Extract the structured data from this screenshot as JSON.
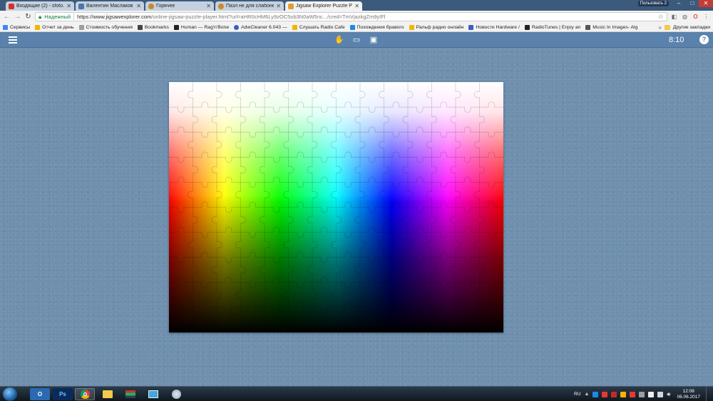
{
  "browser": {
    "tabs": [
      {
        "title": "Входящие (2) - sfoto.onl@",
        "favicon_color": "#d93025",
        "active": false
      },
      {
        "title": "Валентин Маслаков",
        "favicon_color": "#4a76a8",
        "active": false
      },
      {
        "title": "Горячее",
        "favicon_color": "#c88a2a",
        "active": false
      },
      {
        "title": "Пазл не для слабонервных",
        "favicon_color": "#c88a2a",
        "active": false
      },
      {
        "title": "Jigsaw Explorer Puzzle P",
        "favicon_color": "#e0a030",
        "active": true
      }
    ],
    "profile_label": "Пользовать 2",
    "close_symbol": "✕",
    "address": {
      "secure_label": "Надежный",
      "url_host": "https://www.jigsawexplorer.com",
      "url_rest": "/online-jigsaw-puzzle-player.html?url=aHR0cHM6Ly9zOC5ob3N0aW5nc.../cred=TmVjazkgZm9yIFl"
    },
    "bookmarks": [
      {
        "label": "Сервисы",
        "color": "#4285f4"
      },
      {
        "label": "Отчет за день",
        "color": "#f4b400"
      },
      {
        "label": "Стоимость обучения",
        "color": "#9e9e9e"
      },
      {
        "label": "Bookmarks",
        "color": "#444444"
      },
      {
        "label": "Human — Rag'n'Bone",
        "color": "#222222"
      },
      {
        "label": "AdwCleaner 6.043 —",
        "color": "#3b5fc0"
      },
      {
        "label": "Слушать Radio Cafe",
        "color": "#f4b400"
      },
      {
        "label": "Похождения бравого",
        "color": "#1e88e5"
      },
      {
        "label": "Ральф радио онлайн",
        "color": "#f4b400"
      },
      {
        "label": "Новости Hardware /",
        "color": "#3b5fc0"
      },
      {
        "label": "RadioTunes | Enjoy an",
        "color": "#222222"
      },
      {
        "label": "Music In Images- Alg",
        "color": "#555555"
      }
    ],
    "other_bookmarks": "Другие закладки"
  },
  "app": {
    "timer": "8:10",
    "help_label": "?",
    "tools": [
      {
        "name": "hand-tool-icon",
        "glyph": "✋"
      },
      {
        "name": "fullscreen-icon",
        "glyph": "▭"
      },
      {
        "name": "image-preview-icon",
        "glyph": "▣"
      }
    ]
  },
  "taskbar": {
    "items": [
      {
        "name": "taskbar-outlook",
        "label": "O",
        "color": "#2b6ab3"
      },
      {
        "name": "taskbar-photoshop",
        "label": "Ps",
        "color": "#0a2a5c"
      },
      {
        "name": "taskbar-chrome",
        "label": "",
        "color": "#ffffff"
      },
      {
        "name": "taskbar-explorer",
        "label": "",
        "color": "#f2c94c"
      },
      {
        "name": "taskbar-media",
        "label": "",
        "color": "#c0392b"
      },
      {
        "name": "taskbar-network",
        "label": "",
        "color": "#4aa3df"
      },
      {
        "name": "taskbar-app",
        "label": "",
        "color": "#8fa9c2"
      }
    ],
    "language": "RU",
    "time": "12:08",
    "date": "06.06.2017"
  },
  "colors": {
    "background": "#6f8fae",
    "header": "#5a82ac"
  }
}
